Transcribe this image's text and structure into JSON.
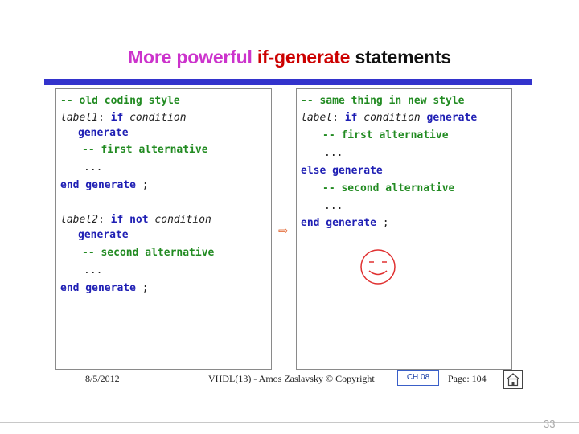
{
  "slide": {
    "title_part1": "More powerful ",
    "title_part2": "if-generate",
    "title_part3": " statements",
    "page_number": "33"
  },
  "left_code": {
    "l1": "-- old coding style",
    "l2_label": "label1",
    "l2_colon": ": ",
    "l2_if": "if",
    "l2_cond": " condition",
    "l3": "generate",
    "l4": "-- first alternative",
    "l5": "...",
    "l6_end": "end generate",
    "l6_semi": " ;",
    "l7_label": "label2",
    "l7_colon": ": ",
    "l7_ifnot": "if not",
    "l7_cond": " condition",
    "l8": "generate",
    "l9": "-- second alternative",
    "l10": "...",
    "l11_end": "end generate",
    "l11_semi": " ;"
  },
  "right_code": {
    "l1": "-- same thing in new style",
    "l2_label": "label",
    "l2_colon": ": ",
    "l2_if": "if",
    "l2_cond": " condition ",
    "l2_gen": "generate",
    "l3": "-- first alternative",
    "l4": "...",
    "l5": "else generate",
    "l6": "-- second alternative",
    "l7": "...",
    "l8_end": "end generate",
    "l8_semi": " ;"
  },
  "arrow_glyph": "⇨",
  "footer": {
    "date": "8/5/2012",
    "copyright": "VHDL(13) - Amos Zaslavsky © Copyright",
    "chapter": "CH 08",
    "page": "Page: 104"
  },
  "colors": {
    "keyword": "#1f1fb4",
    "comment": "#228b22",
    "title_magenta": "#cc33cc",
    "title_red": "#cc0000",
    "rule_blue": "#3333cc",
    "smiley_red": "#e03030"
  }
}
